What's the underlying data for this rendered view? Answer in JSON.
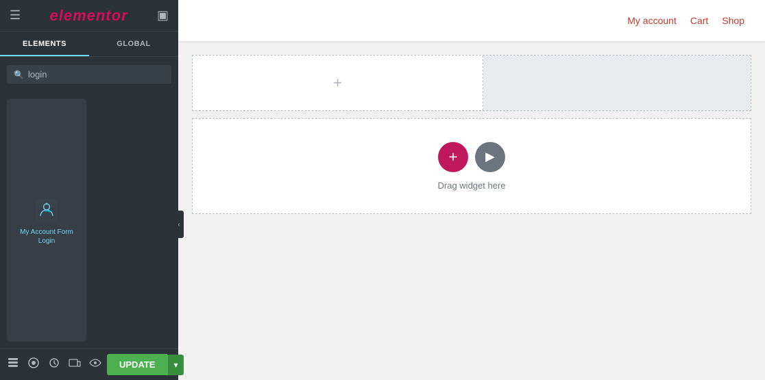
{
  "header": {
    "logo": "elementor",
    "nav_links": [
      {
        "label": "My account",
        "id": "my-account"
      },
      {
        "label": "Cart",
        "id": "cart"
      },
      {
        "label": "Shop",
        "id": "shop"
      }
    ]
  },
  "sidebar": {
    "tabs": [
      {
        "label": "ELEMENTS",
        "active": true
      },
      {
        "label": "GLOBAL",
        "active": false
      }
    ],
    "search": {
      "placeholder": "login",
      "value": "login"
    },
    "widgets": [
      {
        "id": "my-account-form-login",
        "label": "My Account Form Login",
        "icon": "account-form-icon"
      }
    ]
  },
  "toolbar": {
    "icons": [
      "layers-icon",
      "style-icon",
      "history-icon",
      "responsive-icon",
      "eye-icon"
    ],
    "update_label": "UPDATE",
    "dropdown_label": "▾"
  },
  "canvas": {
    "sections": [
      {
        "id": "section-1",
        "has_add": true,
        "add_label": "+"
      },
      {
        "id": "section-2",
        "empty": true,
        "drag_label": "Drag widget here"
      }
    ]
  },
  "colors": {
    "accent_red": "#c0185c",
    "link_color": "#c0392b",
    "active_tab_line": "#71d7f7",
    "widget_label": "#71d7f7",
    "update_green": "#4caf50",
    "sidebar_bg": "#2c3338"
  }
}
